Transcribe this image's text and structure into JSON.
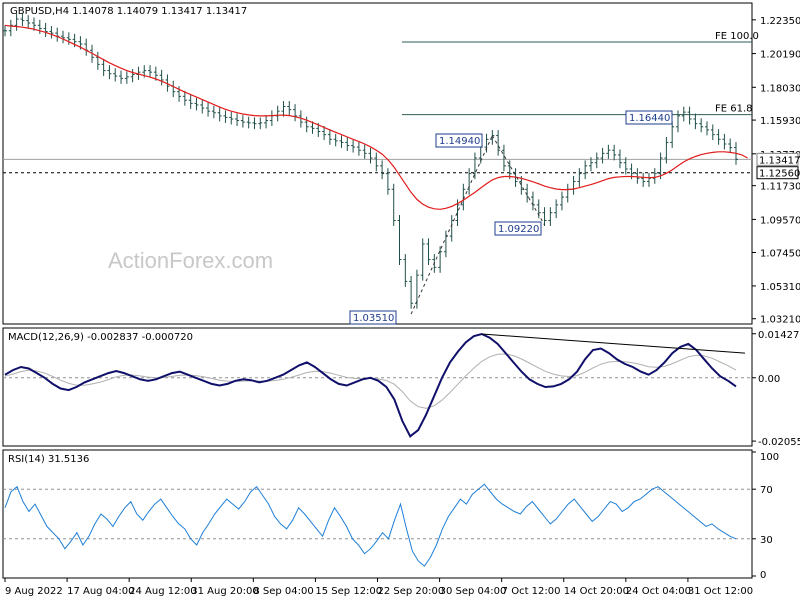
{
  "chart_data": {
    "type": "line",
    "symbol_header": "GBPUSD,H4  1.14078 1.14079 1.13417 1.13417",
    "watermark": "ActionForex.com",
    "x_labels": [
      "9 Aug 2022",
      "17 Aug 04:00",
      "24 Aug 12:00",
      "31 Aug 20:00",
      "8 Sep 04:00",
      "15 Sep 12:00",
      "22 Sep 20:00",
      "30 Sep 04:00",
      "7 Oct 12:00",
      "14 Oct 20:00",
      "24 Oct 04:00",
      "31 Oct 12:00"
    ],
    "price_panel": {
      "ylim": [
        1.03,
        1.233
      ],
      "y_ticks": [
        "1.22350",
        "1.20190",
        "1.18030",
        "1.15930",
        "1.13770",
        "1.11730",
        "1.09570",
        "1.07450",
        "1.05310",
        "1.03210"
      ],
      "current_price_label": "1.13417",
      "support_label": "1.12560",
      "fe_levels": [
        {
          "label": "FE 100.0",
          "value": 1.2093
        },
        {
          "label": "FE 61.8",
          "value": 1.1628
        }
      ],
      "swing_labels": [
        {
          "label": "1.14940",
          "value": 1.1494
        },
        {
          "label": "1.16440",
          "value": 1.1644
        },
        {
          "label": "1.09220",
          "value": 1.0922
        },
        {
          "label": "1.03510",
          "value": 1.0351
        }
      ],
      "price_close": [
        1.2165,
        1.22,
        1.224,
        1.223,
        1.2215,
        1.22,
        1.218,
        1.216,
        1.215,
        1.213,
        1.212,
        1.211,
        1.2095,
        1.208,
        1.204,
        1.1995,
        1.195,
        1.191,
        1.189,
        1.1875,
        1.186,
        1.187,
        1.1885,
        1.19,
        1.191,
        1.19,
        1.188,
        1.185,
        1.181,
        1.1775,
        1.1745,
        1.172,
        1.17,
        1.169,
        1.167,
        1.165,
        1.164,
        1.162,
        1.161,
        1.16,
        1.159,
        1.158,
        1.1575,
        1.157,
        1.1575,
        1.159,
        1.162,
        1.165,
        1.168,
        1.166,
        1.162,
        1.158,
        1.155,
        1.154,
        1.152,
        1.15,
        1.147,
        1.146,
        1.145,
        1.143,
        1.142,
        1.14,
        1.138,
        1.135,
        1.13,
        1.125,
        1.115,
        1.095,
        1.07,
        1.056,
        1.042,
        1.06,
        1.08,
        1.07,
        1.065,
        1.075,
        1.085,
        1.095,
        1.105,
        1.115,
        1.125,
        1.135,
        1.142,
        1.147,
        1.1494,
        1.14,
        1.13,
        1.125,
        1.12,
        1.115,
        1.11,
        1.105,
        1.1,
        1.095,
        1.1,
        1.105,
        1.11,
        1.115,
        1.12,
        1.125,
        1.13,
        1.132,
        1.135,
        1.138,
        1.14,
        1.137,
        1.132,
        1.128,
        1.125,
        1.122,
        1.12,
        1.122,
        1.125,
        1.135,
        1.145,
        1.155,
        1.162,
        1.1644,
        1.16,
        1.157,
        1.155,
        1.153,
        1.15,
        1.147,
        1.144,
        1.1417,
        1.1342
      ],
      "ma_close": [
        1.22,
        1.2195,
        1.2192,
        1.2188,
        1.2182,
        1.2175,
        1.2165,
        1.2155,
        1.2142,
        1.2128,
        1.2112,
        1.2095,
        1.2078,
        1.206,
        1.204,
        1.202,
        1.2,
        1.198,
        1.196,
        1.1942,
        1.1925,
        1.191,
        1.1898,
        1.1888,
        1.1878,
        1.1868,
        1.1856,
        1.1842,
        1.1826,
        1.1808,
        1.179,
        1.1772,
        1.1756,
        1.174,
        1.1724,
        1.1708,
        1.1692,
        1.1676,
        1.1662,
        1.165,
        1.164,
        1.1632,
        1.1626,
        1.1622,
        1.162,
        1.162,
        1.1622,
        1.1624,
        1.1625,
        1.1622,
        1.1615,
        1.1605,
        1.1592,
        1.1578,
        1.1562,
        1.1546,
        1.153,
        1.1515,
        1.15,
        1.1485,
        1.147,
        1.1455,
        1.144,
        1.1422,
        1.14,
        1.1375,
        1.134,
        1.1295,
        1.124,
        1.1185,
        1.113,
        1.1085,
        1.1055,
        1.1035,
        1.1025,
        1.1022,
        1.1028,
        1.104,
        1.1058,
        1.108,
        1.1105,
        1.113,
        1.1158,
        1.1185,
        1.121,
        1.1225,
        1.1232,
        1.1232,
        1.1228,
        1.122,
        1.121,
        1.1198,
        1.1185,
        1.117,
        1.116,
        1.1152,
        1.1148,
        1.1148,
        1.1152,
        1.116,
        1.117,
        1.118,
        1.1192,
        1.1205,
        1.1218,
        1.1226,
        1.123,
        1.1232,
        1.1232,
        1.123,
        1.1226,
        1.1224,
        1.1226,
        1.1236,
        1.1252,
        1.1274,
        1.13,
        1.1325,
        1.1345,
        1.136,
        1.1372,
        1.138,
        1.1386,
        1.139,
        1.139,
        1.1386,
        1.138,
        1.137,
        1.135
      ]
    },
    "macd_panel": {
      "title": "MACD(12,26,9) -0.002837 -0.000720",
      "ylim": [
        -0.0215,
        0.0155
      ],
      "y_ticks": [
        0.014278,
        0.0,
        -0.020556
      ],
      "y_tick_labels": [
        "0.014278",
        "0.00",
        "-0.020556"
      ],
      "macd": [
        0.001,
        0.0025,
        0.0035,
        0.003,
        0.0015,
        0.0,
        -0.002,
        -0.0035,
        -0.004,
        -0.003,
        -0.0015,
        -0.0005,
        0.0005,
        0.0015,
        0.0022,
        0.0015,
        0.0005,
        -0.0005,
        -0.001,
        -0.0005,
        0.0005,
        0.0015,
        0.002,
        0.001,
        0.0,
        -0.001,
        -0.002,
        -0.0025,
        -0.002,
        -0.001,
        -0.0005,
        -0.0008,
        -0.0015,
        -0.001,
        0.0,
        0.001,
        0.0025,
        0.004,
        0.005,
        0.0035,
        0.0015,
        -0.0005,
        -0.002,
        -0.0025,
        -0.0015,
        -0.0005,
        0.0,
        -0.001,
        -0.003,
        -0.007,
        -0.014,
        -0.019,
        -0.017,
        -0.012,
        -0.006,
        0.0,
        0.005,
        0.0085,
        0.0115,
        0.0135,
        0.0142,
        0.013,
        0.011,
        0.008,
        0.005,
        0.002,
        -0.0005,
        -0.002,
        -0.003,
        -0.0028,
        -0.002,
        -0.0005,
        0.002,
        0.006,
        0.009,
        0.0095,
        0.008,
        0.006,
        0.0045,
        0.0035,
        0.002,
        0.001,
        0.0025,
        0.005,
        0.008,
        0.01,
        0.011,
        0.009,
        0.006,
        0.003,
        0.0005,
        -0.001,
        -0.0028
      ],
      "signal": [
        0.0005,
        0.0012,
        0.002,
        0.0025,
        0.0022,
        0.0015,
        0.0004,
        -0.0008,
        -0.0018,
        -0.0024,
        -0.0024,
        -0.002,
        -0.0014,
        -0.0006,
        0.0003,
        0.0008,
        0.0009,
        0.0006,
        0.0002,
        0.0,
        0.0001,
        0.0004,
        0.0008,
        0.0009,
        0.0007,
        0.0003,
        -0.0002,
        -0.0008,
        -0.0011,
        -0.0012,
        -0.0011,
        -0.001,
        -0.0011,
        -0.0011,
        -0.0009,
        -0.0005,
        0.0001,
        0.0009,
        0.0017,
        0.0021,
        0.002,
        0.0015,
        0.0008,
        0.0001,
        -0.0002,
        -0.0003,
        -0.0002,
        -0.0004,
        -0.0009,
        -0.0021,
        -0.0045,
        -0.0075,
        -0.0094,
        -0.0099,
        -0.0091,
        -0.0073,
        -0.0048,
        -0.0021,
        0.0006,
        0.0031,
        0.0053,
        0.0068,
        0.0076,
        0.0077,
        0.0072,
        0.0061,
        0.0048,
        0.0034,
        0.0021,
        0.0012,
        0.0006,
        0.0004,
        0.0007,
        0.0018,
        0.0032,
        0.0044,
        0.0051,
        0.0053,
        0.0052,
        0.0049,
        0.0043,
        0.0036,
        0.0034,
        0.0037,
        0.0046,
        0.0057,
        0.0068,
        0.0073,
        0.0071,
        0.0063,
        0.0051,
        0.0039,
        0.0025
      ],
      "divergence_line": [
        [
          0.0142,
          60
        ],
        [
          0.008,
          92
        ]
      ]
    },
    "rsi_panel": {
      "title": "RSI(14) 31.5136",
      "ylim": [
        0,
        100
      ],
      "y_ticks": [
        100,
        70,
        30,
        0
      ],
      "levels": [
        70,
        30
      ],
      "rsi": [
        55,
        68,
        72,
        60,
        52,
        58,
        49,
        40,
        35,
        30,
        22,
        28,
        35,
        25,
        32,
        42,
        50,
        46,
        40,
        48,
        55,
        60,
        50,
        45,
        52,
        58,
        62,
        55,
        48,
        42,
        38,
        30,
        25,
        35,
        42,
        50,
        56,
        62,
        58,
        54,
        60,
        68,
        72,
        65,
        58,
        48,
        42,
        38,
        45,
        55,
        50,
        44,
        38,
        32,
        45,
        55,
        48,
        40,
        30,
        25,
        18,
        22,
        28,
        35,
        30,
        45,
        58,
        38,
        20,
        12,
        8,
        15,
        25,
        38,
        48,
        55,
        62,
        58,
        66,
        70,
        74,
        68,
        62,
        58,
        55,
        52,
        50,
        56,
        60,
        54,
        48,
        42,
        46,
        52,
        58,
        62,
        56,
        50,
        44,
        48,
        54,
        60,
        58,
        52,
        55,
        60,
        62,
        66,
        70,
        72,
        68,
        64,
        60,
        56,
        52,
        48,
        44,
        40,
        42,
        38,
        35,
        32,
        30
      ]
    }
  }
}
